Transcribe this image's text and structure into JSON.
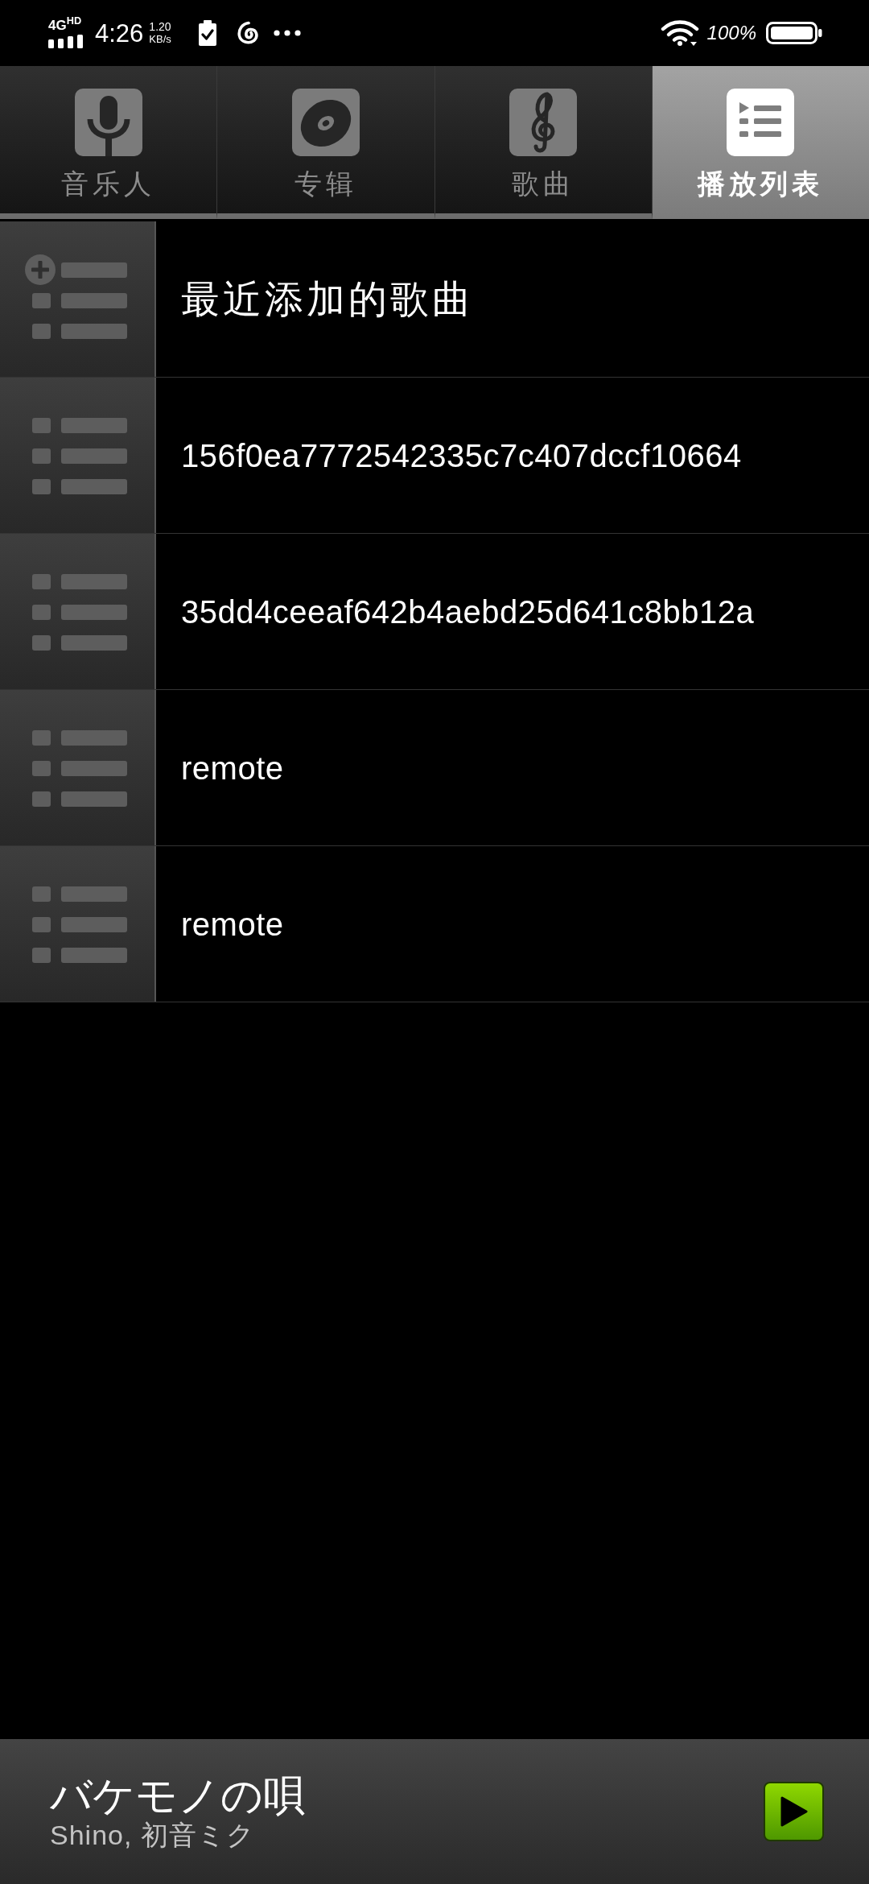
{
  "status_bar": {
    "network": "4G$^{HD}$",
    "time": "4:26",
    "net_speed": "1.20",
    "net_speed_unit": "KB/s",
    "battery": "100%"
  },
  "tabs": [
    {
      "label": "音乐人",
      "selected": false
    },
    {
      "label": "专辑",
      "selected": false
    },
    {
      "label": "歌曲",
      "selected": false
    },
    {
      "label": "播放列表",
      "selected": true
    }
  ],
  "playlists": [
    {
      "kind": "smart",
      "title": "最近添加的歌曲"
    },
    {
      "kind": "user",
      "title": "156f0ea7772542335c7c407dccf10664"
    },
    {
      "kind": "user",
      "title": "35dd4ceeaf642b4aebd25d641c8bb12a"
    },
    {
      "kind": "user",
      "title": "remote"
    },
    {
      "kind": "user",
      "title": "remote"
    }
  ],
  "now_playing": {
    "title": "バケモノの唄",
    "artist": "Shino, 初音ミク"
  }
}
